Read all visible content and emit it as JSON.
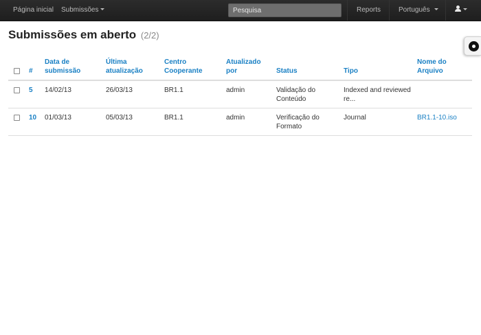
{
  "navbar": {
    "home_label": "Página inicial",
    "submissions_label": "Submissões",
    "search_placeholder": "Pesquisa",
    "reports_label": "Reports",
    "language_label": "Português"
  },
  "page": {
    "title": "Submissões em aberto",
    "count": "(2/2)"
  },
  "table": {
    "headers": {
      "id": "#",
      "submitted_l1": "Data de",
      "submitted_l2": "submissão",
      "updated_l1": "Última",
      "updated_l2": "atualização",
      "center_l1": "Centro",
      "center_l2": "Cooperante",
      "updated_by_l1": "Atualizado",
      "updated_by_l2": "por",
      "status": "Status",
      "type": "Tipo",
      "file_l1": "Nome do",
      "file_l2": "Arquivo"
    },
    "rows": [
      {
        "id": "5",
        "submitted": "14/02/13",
        "updated": "26/03/13",
        "center": "BR1.1",
        "updated_by": "admin",
        "status_l1": "Validação do",
        "status_l2": "Conteúdo",
        "type_l1": "Indexed and reviewed",
        "type_l2": "re...",
        "file": ""
      },
      {
        "id": "10",
        "submitted": "01/03/13",
        "updated": "05/03/13",
        "center": "BR1.1",
        "updated_by": "admin",
        "status_l1": "Verificação do",
        "status_l2": "Formato",
        "type_l1": "Journal",
        "type_l2": "",
        "file": "BR1.1-10.iso"
      }
    ]
  }
}
